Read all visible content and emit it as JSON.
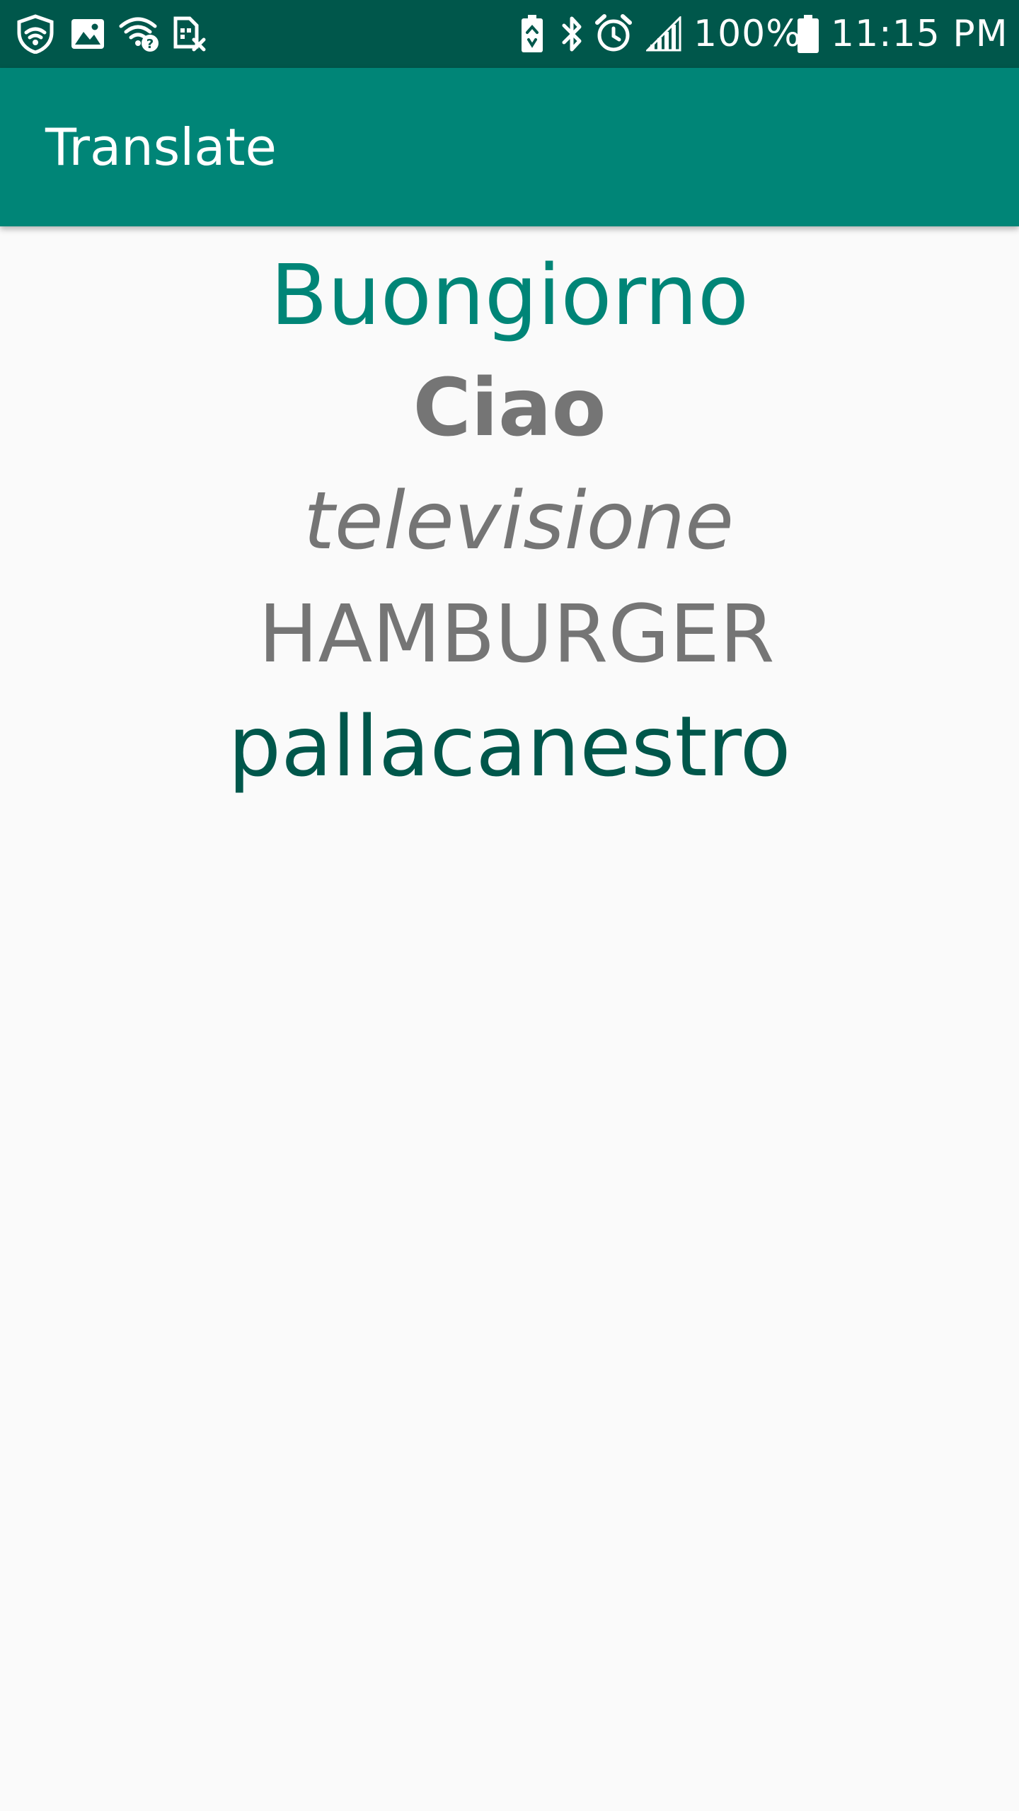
{
  "status_bar": {
    "left_icons": [
      "shield-icon",
      "image-icon",
      "wifi-question-icon",
      "no-sim-icon"
    ],
    "right_icons": [
      "battery-saver-icon",
      "bluetooth-icon",
      "alarm-icon",
      "signal-icon"
    ],
    "battery_percent": "100%",
    "battery_icon": "battery-full-icon",
    "time": "11:15 PM"
  },
  "app_bar": {
    "title": "Translate"
  },
  "words": [
    "Buongiorno",
    "Ciao",
    "televisione",
    "HAMBURGER",
    "pallacanestro"
  ],
  "colors": {
    "primary": "#008577",
    "primary_dark": "#00574b",
    "grey_text": "#757575",
    "background": "#fafafa"
  }
}
